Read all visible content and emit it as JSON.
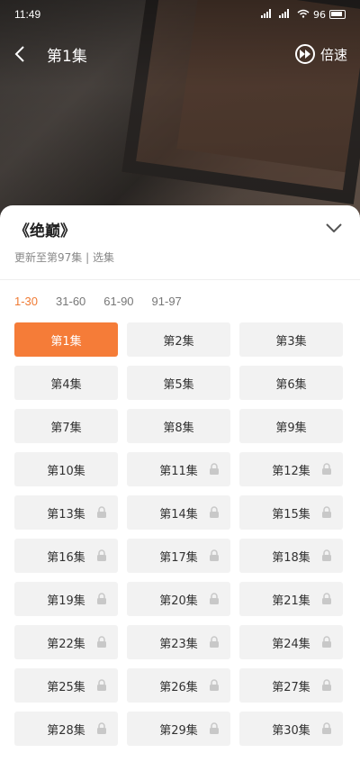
{
  "status": {
    "time": "11:49",
    "battery": "96"
  },
  "player": {
    "title": "第1集",
    "speed_label": "倍速"
  },
  "drama": {
    "title": "《绝巅》",
    "subtitle": "更新至第97集 | 选集"
  },
  "ranges": [
    "1-30",
    "31-60",
    "61-90",
    "91-97"
  ],
  "active_range": 0,
  "episodes": [
    {
      "label": "第1集",
      "locked": false
    },
    {
      "label": "第2集",
      "locked": false
    },
    {
      "label": "第3集",
      "locked": false
    },
    {
      "label": "第4集",
      "locked": false
    },
    {
      "label": "第5集",
      "locked": false
    },
    {
      "label": "第6集",
      "locked": false
    },
    {
      "label": "第7集",
      "locked": false
    },
    {
      "label": "第8集",
      "locked": false
    },
    {
      "label": "第9集",
      "locked": false
    },
    {
      "label": "第10集",
      "locked": false
    },
    {
      "label": "第11集",
      "locked": true
    },
    {
      "label": "第12集",
      "locked": true
    },
    {
      "label": "第13集",
      "locked": true
    },
    {
      "label": "第14集",
      "locked": true
    },
    {
      "label": "第15集",
      "locked": true
    },
    {
      "label": "第16集",
      "locked": true
    },
    {
      "label": "第17集",
      "locked": true
    },
    {
      "label": "第18集",
      "locked": true
    },
    {
      "label": "第19集",
      "locked": true
    },
    {
      "label": "第20集",
      "locked": true
    },
    {
      "label": "第21集",
      "locked": true
    },
    {
      "label": "第22集",
      "locked": true
    },
    {
      "label": "第23集",
      "locked": true
    },
    {
      "label": "第24集",
      "locked": true
    },
    {
      "label": "第25集",
      "locked": true
    },
    {
      "label": "第26集",
      "locked": true
    },
    {
      "label": "第27集",
      "locked": true
    },
    {
      "label": "第28集",
      "locked": true
    },
    {
      "label": "第29集",
      "locked": true
    },
    {
      "label": "第30集",
      "locked": true
    }
  ],
  "active_episode": 0,
  "colors": {
    "accent": "#f57c38",
    "tile": "#f2f2f2"
  }
}
